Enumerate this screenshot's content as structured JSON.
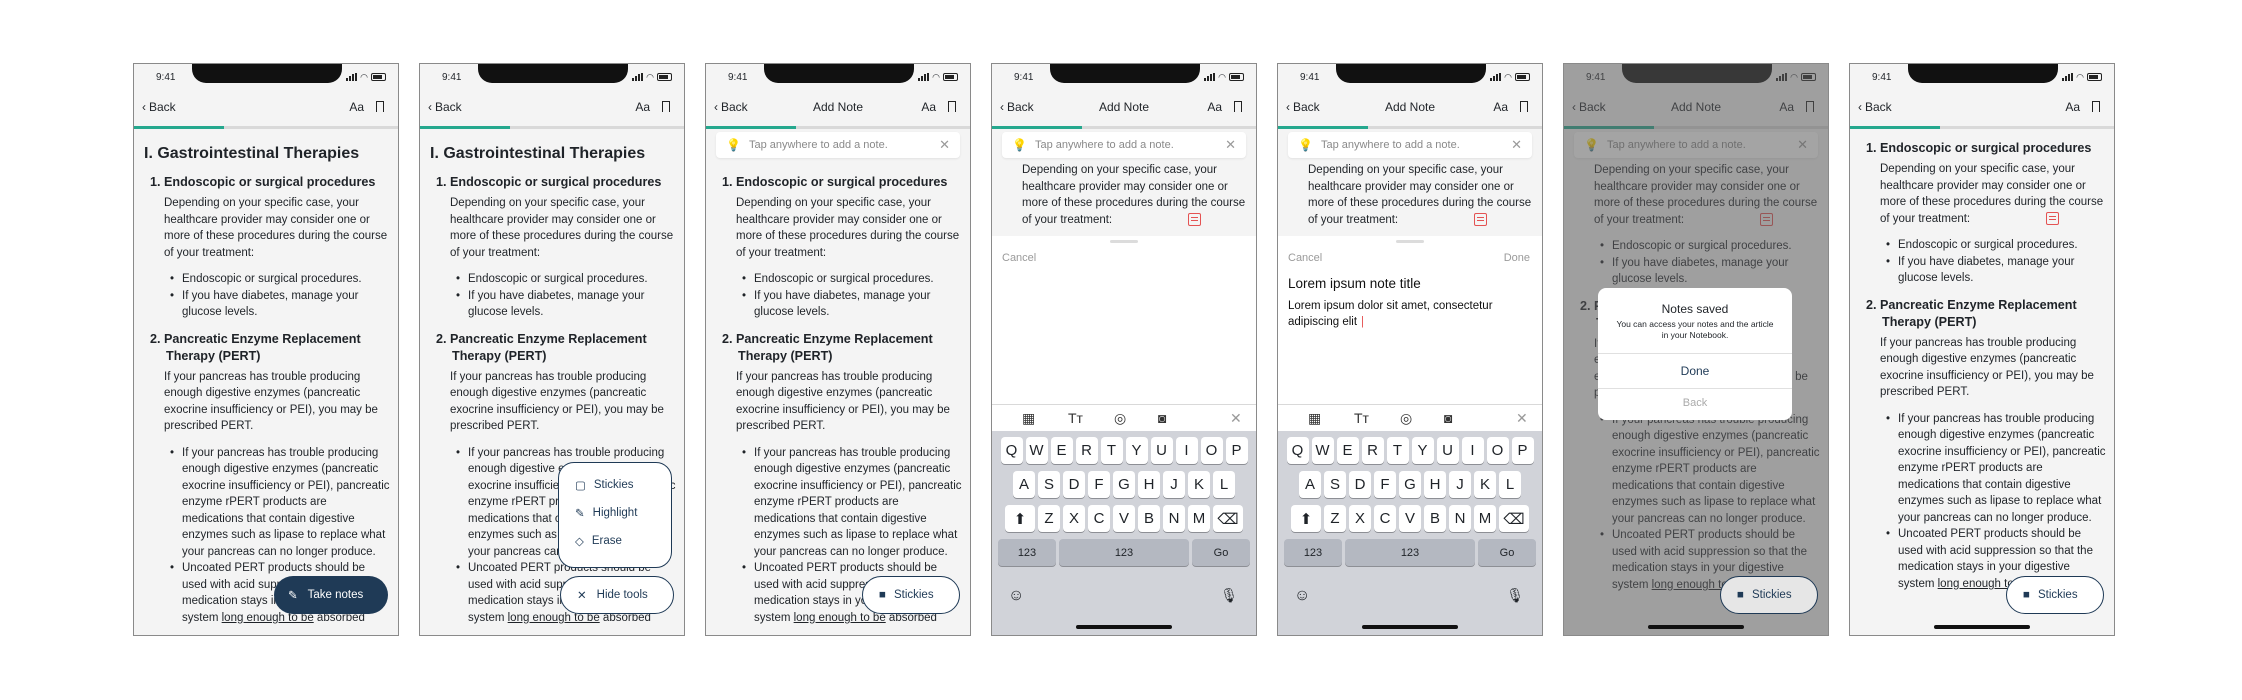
{
  "status": {
    "time": "9:41"
  },
  "nav": {
    "back": "Back",
    "aa": "Aa",
    "add_note_title": "Add Note"
  },
  "article": {
    "title": "I. Gastrointestinal Therapies",
    "s1_title": "1. Endoscopic or surgical procedures",
    "s1_p1": "Depending on your specific case, your",
    "s1_p2": "healthcare provider may consider one or",
    "s1_p3": "more of these procedures during the course",
    "s1_p4": "of your treatment:",
    "s1_b1": "Endoscopic or surgical procedures.",
    "s1_b2a": "If you have diabetes, manage your",
    "s1_b2b": "glucose levels.",
    "s2_t1": "2. Pancreatic Enzyme Replacement",
    "s2_t2": "Therapy (PERT)",
    "s2_p1": "If your pancreas has trouble producing",
    "s2_p2": "enough digestive enzymes (pancreatic",
    "s2_p3": "exocrine insufficiency or PEI), you may be",
    "s2_p4": "prescribed PERT.",
    "s2_b1a": "If your pancreas has trouble producing",
    "s2_b1b": "enough digestive enzymes (pancreatic",
    "s2_b1c": "exocrine insufficiency or PEI), pancreatic",
    "s2_b1d": "enzyme rPERT products are",
    "s2_b1e": "medications that contain digestive",
    "s2_b1f": "enzymes such as lipase to replace what",
    "s2_b1g": "your pancreas can no longer produce.",
    "s2_b2a": "Uncoated PERT products should be",
    "s2_b2b": "used with acid suppression so that the",
    "s2_b2c": "medication stays in your digestive",
    "s2_b2d": "system",
    "s2_b2e": "long enough to be",
    "s2_b2f": "absorbed"
  },
  "fab": {
    "take_notes": "Take notes",
    "stickies": "Stickies",
    "hide_tools": "Hide tools"
  },
  "menu": {
    "stickies": "Stickies",
    "highlight": "Highlight",
    "erase": "Erase"
  },
  "banner": {
    "text": "Tap anywhere to add a note."
  },
  "sheet": {
    "cancel": "Cancel",
    "done": "Done",
    "note_title": "Lorem ipsum note title",
    "note_body1": "Lorem ipsum dolor sit amet, consectetur",
    "note_body2": "adipiscing elit"
  },
  "keyboard": {
    "row1": [
      "Q",
      "W",
      "E",
      "R",
      "T",
      "Y",
      "U",
      "I",
      "O",
      "P"
    ],
    "row2": [
      "A",
      "S",
      "D",
      "F",
      "G",
      "H",
      "J",
      "K",
      "L"
    ],
    "row3": [
      "Z",
      "X",
      "C",
      "V",
      "B",
      "N",
      "M"
    ],
    "num": "123",
    "space": "123",
    "go": "Go"
  },
  "dialog": {
    "title": "Notes saved",
    "body1": "You can access your notes and the article",
    "body2": "in your Notebook.",
    "done": "Done",
    "back": "Back"
  },
  "colors": {
    "accent": "#25a88e",
    "navy": "#1f3a56",
    "note_icon": "#e45252"
  }
}
